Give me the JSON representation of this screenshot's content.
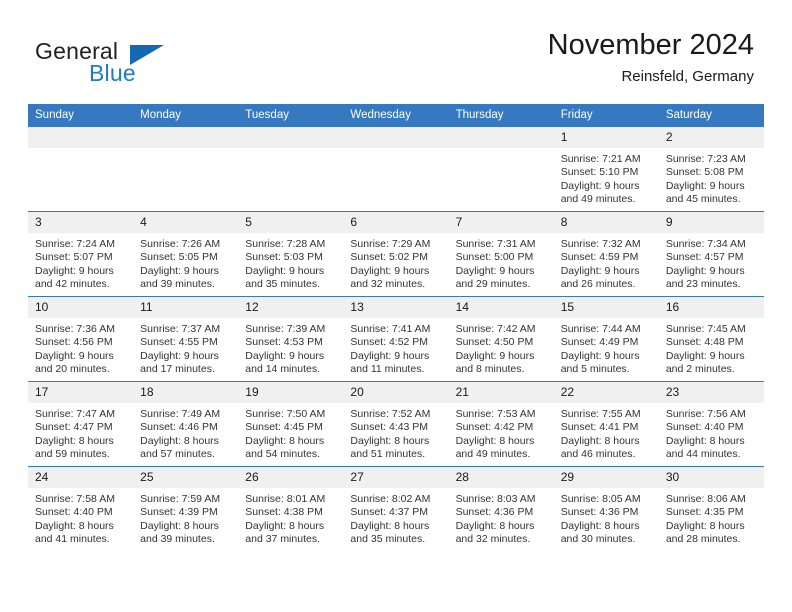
{
  "brand": {
    "name_part1": "General",
    "name_part2": "Blue",
    "triangle_icon": "triangle-icon",
    "accent_color": "#1668b3"
  },
  "header": {
    "title": "November 2024",
    "subtitle": "Reinsfeld, Germany"
  },
  "calendar": {
    "header_color": "#3679c0",
    "weekday_headers": [
      "Sunday",
      "Monday",
      "Tuesday",
      "Wednesday",
      "Thursday",
      "Friday",
      "Saturday"
    ],
    "weeks": [
      [
        {
          "day": "",
          "blank": true,
          "sunrise": "",
          "sunset": "",
          "daylight1": "",
          "daylight2": ""
        },
        {
          "day": "",
          "blank": true,
          "sunrise": "",
          "sunset": "",
          "daylight1": "",
          "daylight2": ""
        },
        {
          "day": "",
          "blank": true,
          "sunrise": "",
          "sunset": "",
          "daylight1": "",
          "daylight2": ""
        },
        {
          "day": "",
          "blank": true,
          "sunrise": "",
          "sunset": "",
          "daylight1": "",
          "daylight2": ""
        },
        {
          "day": "",
          "blank": true,
          "sunrise": "",
          "sunset": "",
          "daylight1": "",
          "daylight2": ""
        },
        {
          "day": "1",
          "sunrise": "Sunrise: 7:21 AM",
          "sunset": "Sunset: 5:10 PM",
          "daylight1": "Daylight: 9 hours",
          "daylight2": "and 49 minutes."
        },
        {
          "day": "2",
          "sunrise": "Sunrise: 7:23 AM",
          "sunset": "Sunset: 5:08 PM",
          "daylight1": "Daylight: 9 hours",
          "daylight2": "and 45 minutes."
        }
      ],
      [
        {
          "day": "3",
          "sunrise": "Sunrise: 7:24 AM",
          "sunset": "Sunset: 5:07 PM",
          "daylight1": "Daylight: 9 hours",
          "daylight2": "and 42 minutes."
        },
        {
          "day": "4",
          "sunrise": "Sunrise: 7:26 AM",
          "sunset": "Sunset: 5:05 PM",
          "daylight1": "Daylight: 9 hours",
          "daylight2": "and 39 minutes."
        },
        {
          "day": "5",
          "sunrise": "Sunrise: 7:28 AM",
          "sunset": "Sunset: 5:03 PM",
          "daylight1": "Daylight: 9 hours",
          "daylight2": "and 35 minutes."
        },
        {
          "day": "6",
          "sunrise": "Sunrise: 7:29 AM",
          "sunset": "Sunset: 5:02 PM",
          "daylight1": "Daylight: 9 hours",
          "daylight2": "and 32 minutes."
        },
        {
          "day": "7",
          "sunrise": "Sunrise: 7:31 AM",
          "sunset": "Sunset: 5:00 PM",
          "daylight1": "Daylight: 9 hours",
          "daylight2": "and 29 minutes."
        },
        {
          "day": "8",
          "sunrise": "Sunrise: 7:32 AM",
          "sunset": "Sunset: 4:59 PM",
          "daylight1": "Daylight: 9 hours",
          "daylight2": "and 26 minutes."
        },
        {
          "day": "9",
          "sunrise": "Sunrise: 7:34 AM",
          "sunset": "Sunset: 4:57 PM",
          "daylight1": "Daylight: 9 hours",
          "daylight2": "and 23 minutes."
        }
      ],
      [
        {
          "day": "10",
          "sunrise": "Sunrise: 7:36 AM",
          "sunset": "Sunset: 4:56 PM",
          "daylight1": "Daylight: 9 hours",
          "daylight2": "and 20 minutes."
        },
        {
          "day": "11",
          "sunrise": "Sunrise: 7:37 AM",
          "sunset": "Sunset: 4:55 PM",
          "daylight1": "Daylight: 9 hours",
          "daylight2": "and 17 minutes."
        },
        {
          "day": "12",
          "sunrise": "Sunrise: 7:39 AM",
          "sunset": "Sunset: 4:53 PM",
          "daylight1": "Daylight: 9 hours",
          "daylight2": "and 14 minutes."
        },
        {
          "day": "13",
          "sunrise": "Sunrise: 7:41 AM",
          "sunset": "Sunset: 4:52 PM",
          "daylight1": "Daylight: 9 hours",
          "daylight2": "and 11 minutes."
        },
        {
          "day": "14",
          "sunrise": "Sunrise: 7:42 AM",
          "sunset": "Sunset: 4:50 PM",
          "daylight1": "Daylight: 9 hours",
          "daylight2": "and 8 minutes."
        },
        {
          "day": "15",
          "sunrise": "Sunrise: 7:44 AM",
          "sunset": "Sunset: 4:49 PM",
          "daylight1": "Daylight: 9 hours",
          "daylight2": "and 5 minutes."
        },
        {
          "day": "16",
          "sunrise": "Sunrise: 7:45 AM",
          "sunset": "Sunset: 4:48 PM",
          "daylight1": "Daylight: 9 hours",
          "daylight2": "and 2 minutes."
        }
      ],
      [
        {
          "day": "17",
          "sunrise": "Sunrise: 7:47 AM",
          "sunset": "Sunset: 4:47 PM",
          "daylight1": "Daylight: 8 hours",
          "daylight2": "and 59 minutes."
        },
        {
          "day": "18",
          "sunrise": "Sunrise: 7:49 AM",
          "sunset": "Sunset: 4:46 PM",
          "daylight1": "Daylight: 8 hours",
          "daylight2": "and 57 minutes."
        },
        {
          "day": "19",
          "sunrise": "Sunrise: 7:50 AM",
          "sunset": "Sunset: 4:45 PM",
          "daylight1": "Daylight: 8 hours",
          "daylight2": "and 54 minutes."
        },
        {
          "day": "20",
          "sunrise": "Sunrise: 7:52 AM",
          "sunset": "Sunset: 4:43 PM",
          "daylight1": "Daylight: 8 hours",
          "daylight2": "and 51 minutes."
        },
        {
          "day": "21",
          "sunrise": "Sunrise: 7:53 AM",
          "sunset": "Sunset: 4:42 PM",
          "daylight1": "Daylight: 8 hours",
          "daylight2": "and 49 minutes."
        },
        {
          "day": "22",
          "sunrise": "Sunrise: 7:55 AM",
          "sunset": "Sunset: 4:41 PM",
          "daylight1": "Daylight: 8 hours",
          "daylight2": "and 46 minutes."
        },
        {
          "day": "23",
          "sunrise": "Sunrise: 7:56 AM",
          "sunset": "Sunset: 4:40 PM",
          "daylight1": "Daylight: 8 hours",
          "daylight2": "and 44 minutes."
        }
      ],
      [
        {
          "day": "24",
          "sunrise": "Sunrise: 7:58 AM",
          "sunset": "Sunset: 4:40 PM",
          "daylight1": "Daylight: 8 hours",
          "daylight2": "and 41 minutes."
        },
        {
          "day": "25",
          "sunrise": "Sunrise: 7:59 AM",
          "sunset": "Sunset: 4:39 PM",
          "daylight1": "Daylight: 8 hours",
          "daylight2": "and 39 minutes."
        },
        {
          "day": "26",
          "sunrise": "Sunrise: 8:01 AM",
          "sunset": "Sunset: 4:38 PM",
          "daylight1": "Daylight: 8 hours",
          "daylight2": "and 37 minutes."
        },
        {
          "day": "27",
          "sunrise": "Sunrise: 8:02 AM",
          "sunset": "Sunset: 4:37 PM",
          "daylight1": "Daylight: 8 hours",
          "daylight2": "and 35 minutes."
        },
        {
          "day": "28",
          "sunrise": "Sunrise: 8:03 AM",
          "sunset": "Sunset: 4:36 PM",
          "daylight1": "Daylight: 8 hours",
          "daylight2": "and 32 minutes."
        },
        {
          "day": "29",
          "sunrise": "Sunrise: 8:05 AM",
          "sunset": "Sunset: 4:36 PM",
          "daylight1": "Daylight: 8 hours",
          "daylight2": "and 30 minutes."
        },
        {
          "day": "30",
          "sunrise": "Sunrise: 8:06 AM",
          "sunset": "Sunset: 4:35 PM",
          "daylight1": "Daylight: 8 hours",
          "daylight2": "and 28 minutes."
        }
      ]
    ]
  }
}
